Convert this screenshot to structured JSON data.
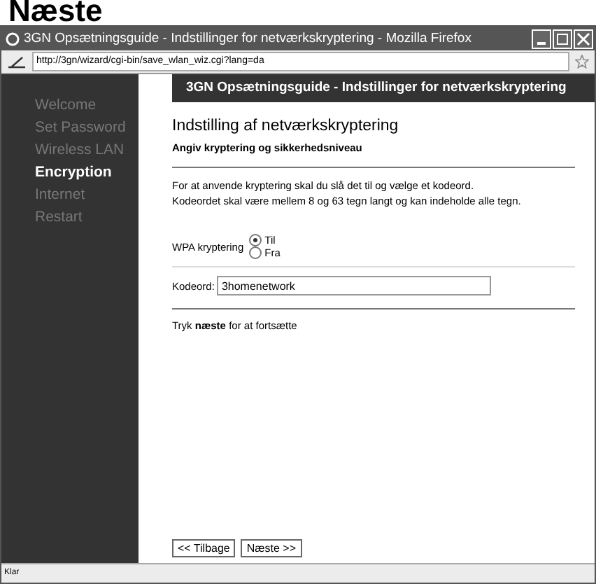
{
  "page_heading": "Næste",
  "window": {
    "title": "3GN Opsætningsguide - Indstillinger for netværkskryptering - Mozilla Firefox"
  },
  "address_bar": {
    "url": "http://3gn/wizard/cgi-bin/save_wlan_wiz.cgi?lang=da"
  },
  "sidebar": {
    "items": [
      {
        "label": "Welcome",
        "selected": false
      },
      {
        "label": "Set Password",
        "selected": false
      },
      {
        "label": "Wireless LAN",
        "selected": false
      },
      {
        "label": "Encryption",
        "selected": true
      },
      {
        "label": "Internet",
        "selected": false
      },
      {
        "label": "Restart",
        "selected": false
      }
    ]
  },
  "header": "3GN Opsætningsguide - Indstillinger for netværkskryptering",
  "section_title": "Indstilling af netværkskryptering",
  "subtitle": "Angiv kryptering og sikkerhedsniveau",
  "description": [
    "For at anvende kryptering skal du slå det til og vælge et kodeord.",
    "Kodeordet skal være mellem 8 og 63 tegn langt og kan indeholde alle tegn."
  ],
  "wpa": {
    "label": "WPA kryptering",
    "options": [
      {
        "label": "Til",
        "selected": true
      },
      {
        "label": "Fra",
        "selected": false
      }
    ]
  },
  "password": {
    "label": "Kodeord:",
    "value": "3homenetwork"
  },
  "hint": "Tryk **næste** for at fortsætte",
  "buttons": [
    "<< Tilbage",
    "Næste >>"
  ],
  "status_bar": "Klar"
}
